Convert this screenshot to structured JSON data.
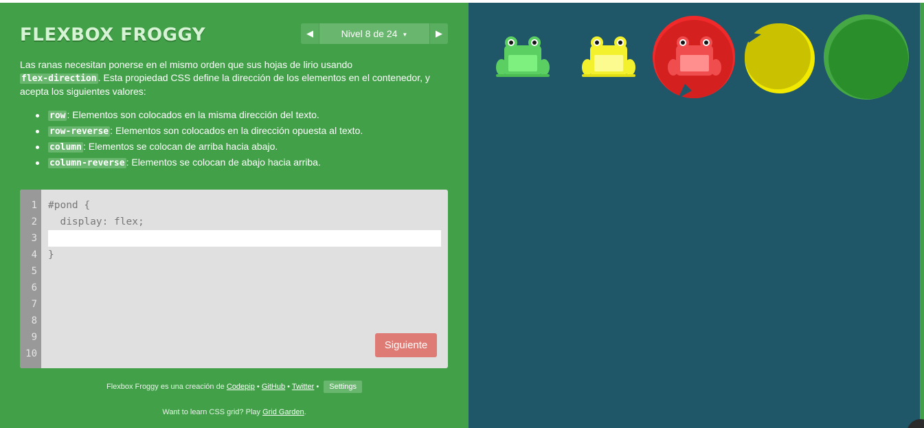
{
  "app": {
    "title": "FLEXBOX FROGGY"
  },
  "level_nav": {
    "prev_icon": "triangle-left-icon",
    "next_icon": "triangle-right-icon",
    "label": "Nivel 8 de 24",
    "dropdown_icon": "caret-down-icon"
  },
  "instructions": {
    "intro_before": "Las ranas necesitan ponerse en el mismo orden que sus hojas de lirio usando",
    "property": "flex-direction",
    "intro_after": ". Esta propiedad CSS define la dirección de los elementos en el contenedor, y acepta los siguientes valores:",
    "values": [
      {
        "keyword": "row",
        "description": ": Elementos son colocados en la misma dirección del texto."
      },
      {
        "keyword": "row-reverse",
        "description": ": Elementos son colocados en la dirección opuesta al texto."
      },
      {
        "keyword": "column",
        "description": ": Elementos se colocan de arriba hacia abajo."
      },
      {
        "keyword": "column-reverse",
        "description": ": Elementos se colocan de abajo hacia arriba."
      }
    ]
  },
  "editor": {
    "line_numbers": [
      "1",
      "2",
      "3",
      "4",
      "5",
      "6",
      "7",
      "8",
      "9",
      "10"
    ],
    "line1": "#pond {",
    "line2": "  display: flex;",
    "input_value": "",
    "line4": "}",
    "next_button": "Siguiente"
  },
  "footer": {
    "credits_prefix": "Flexbox Froggy es una creación de",
    "codepip": "Codepip",
    "github": "GitHub",
    "twitter": "Twitter",
    "separator": "•",
    "settings": "Settings",
    "promo_prefix": "Want to learn CSS grid? Play",
    "grid_garden": "Grid Garden",
    "promo_suffix": "."
  },
  "pond": {
    "frogs": [
      {
        "color": "green",
        "body": "#5ccf62",
        "belly": "#7ef07f"
      },
      {
        "color": "yellow",
        "body": "#f3f02e",
        "belly": "#fbfb8f"
      },
      {
        "color": "red",
        "body": "#f04e4e",
        "belly": "#ff8f8f"
      }
    ],
    "lilypads": [
      {
        "color": "red",
        "fill": "#d52020",
        "rim": "#f02a2a"
      },
      {
        "color": "yellow",
        "fill": "#cac200",
        "rim": "#f1e900"
      },
      {
        "color": "green",
        "fill": "#2a8f2a",
        "rim": "#45a845"
      }
    ]
  },
  "colors": {
    "sidebar_bg": "#42a148",
    "pond_bg": "#1f5768",
    "next_button_bg": "#de7b74",
    "editor_bg": "#e0e0e0"
  }
}
